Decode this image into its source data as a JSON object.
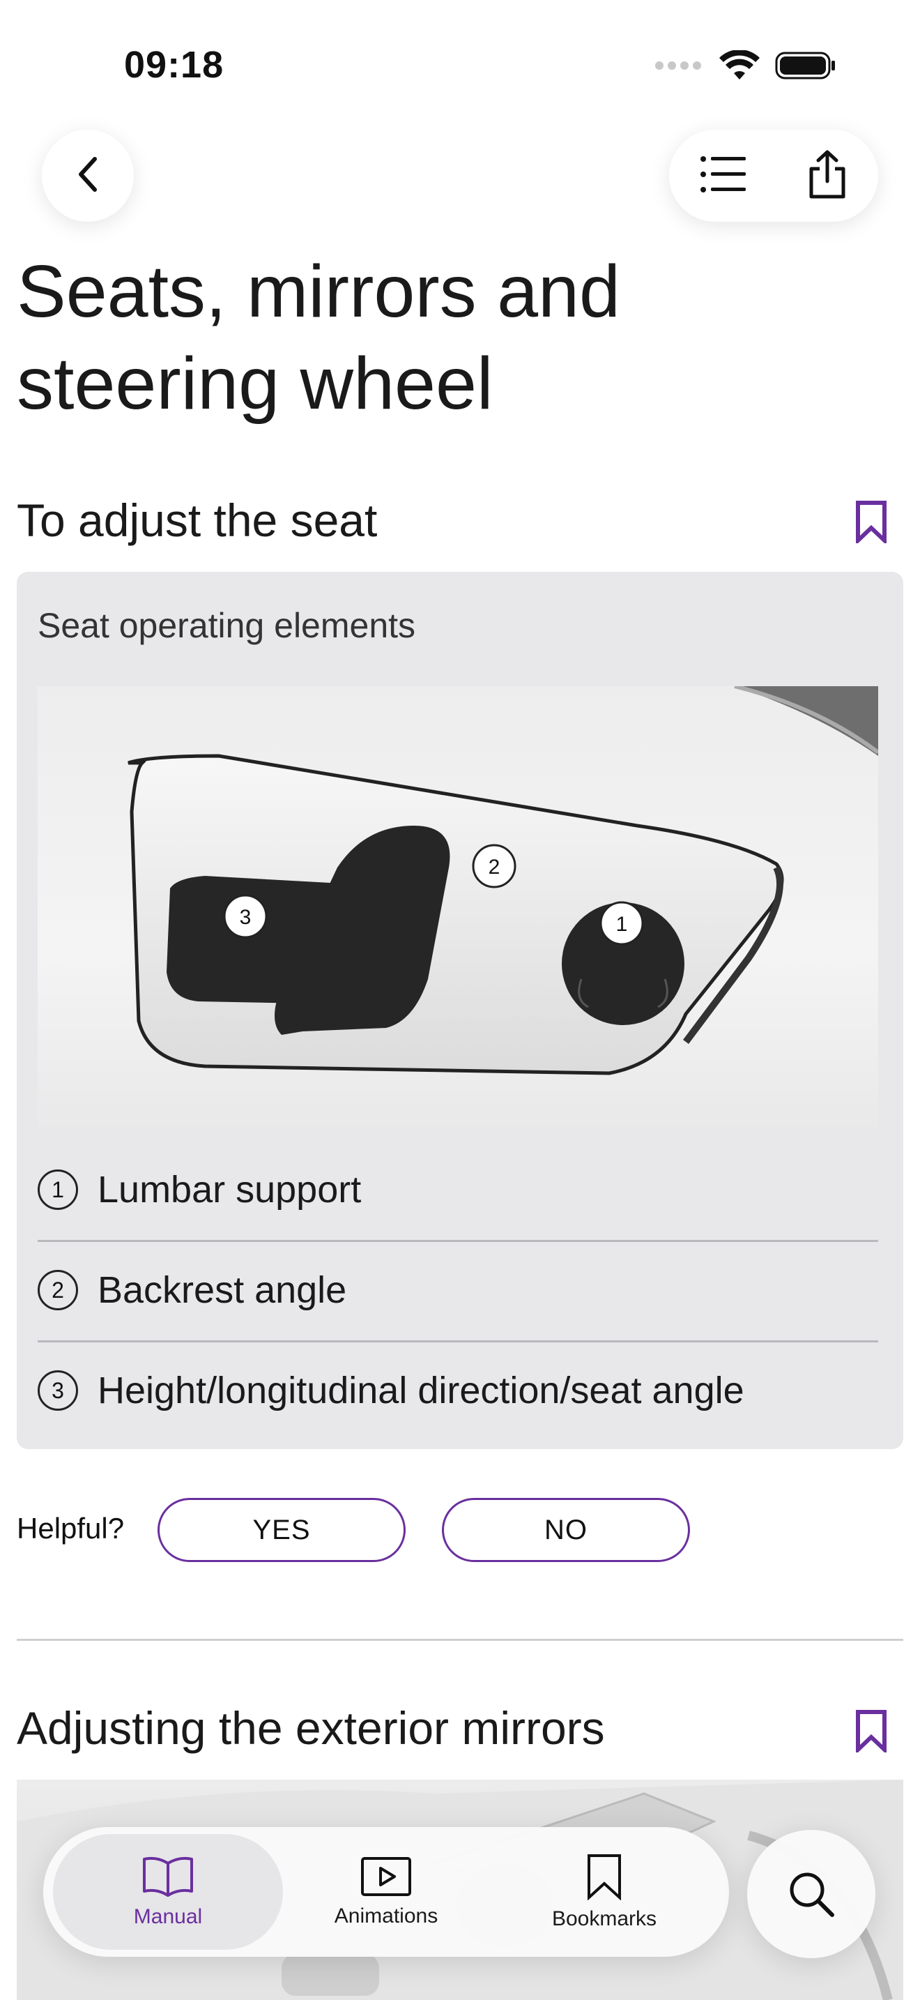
{
  "status_bar": {
    "time": "09:18"
  },
  "page": {
    "title": "Seats, mirrors and steering wheel"
  },
  "section1": {
    "title": "To adjust the seat",
    "figure_caption": "Seat operating elements",
    "callouts": [
      "1",
      "2",
      "3"
    ],
    "legend": [
      {
        "number": "1",
        "label": "Lumbar support"
      },
      {
        "number": "2",
        "label": "Backrest angle"
      },
      {
        "number": "3",
        "label": "Height/longitudinal direction/seat angle"
      }
    ]
  },
  "feedback": {
    "label": "Helpful?",
    "yes": "YES",
    "no": "NO"
  },
  "section2": {
    "title": "Adjusting the exterior mirrors"
  },
  "tabbar": {
    "tabs": [
      {
        "label": "Manual",
        "icon": "book-icon",
        "active": true
      },
      {
        "label": "Animations",
        "icon": "play-icon",
        "active": false
      },
      {
        "label": "Bookmarks",
        "icon": "bookmark-icon",
        "active": false
      }
    ],
    "search_icon": "search-icon"
  },
  "colors": {
    "accent": "#6a2f9e",
    "card_bg": "#e8e7ea"
  }
}
